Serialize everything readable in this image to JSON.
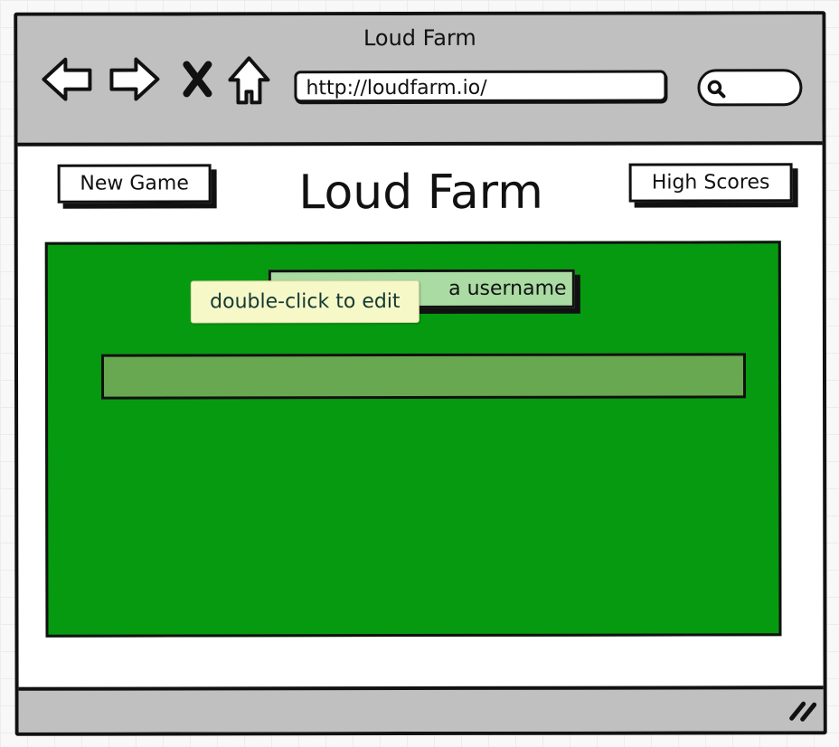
{
  "browser": {
    "title": "Loud Farm",
    "url": "http://loudfarm.io/",
    "icons": [
      "back-arrow-icon",
      "forward-arrow-icon",
      "stop-icon",
      "home-icon",
      "search-icon",
      "resize-grip-icon"
    ]
  },
  "header": {
    "new_game_label": "New Game",
    "title": "Loud Farm",
    "high_scores_label": "High Scores"
  },
  "game": {
    "username_prompt_visible": "a username",
    "username_value": ""
  },
  "tooltip": {
    "text": "double-click to edit"
  },
  "colors": {
    "chrome": "#c0c0c0",
    "game_background": "#069a10",
    "prompt_background": "#a9dba3",
    "input_background": "#68a850",
    "tooltip_background": "#f7f8c8"
  }
}
